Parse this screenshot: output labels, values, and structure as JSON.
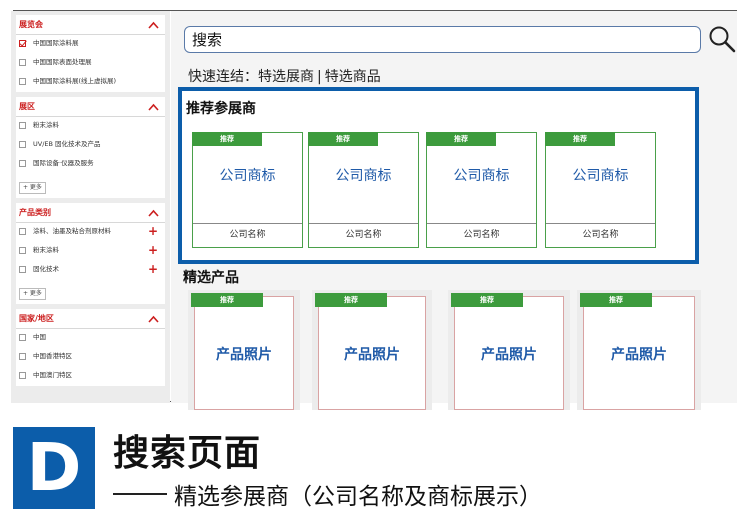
{
  "sidebar": {
    "panels": [
      {
        "title": "展览会",
        "options": [
          {
            "label": "中国国际涂料展",
            "checked": true
          },
          {
            "label": "中国国际表面处理展",
            "checked": false
          },
          {
            "label": "中国国际涂料展(线上虚拟展)",
            "checked": false
          }
        ]
      },
      {
        "title": "展区",
        "options": [
          {
            "label": "粉末涂料",
            "checked": false
          },
          {
            "label": "UV/EB 固化技术及产品",
            "checked": false
          },
          {
            "label": "国际设备·仪器及服务",
            "checked": false
          }
        ],
        "more": "+ 更多"
      },
      {
        "title": "产品类别",
        "options": [
          {
            "label": "涂料、油墨及粘合剂原材料",
            "checked": false
          },
          {
            "label": "粉末涂料",
            "checked": false
          },
          {
            "label": "固化技术",
            "checked": false
          }
        ],
        "more": "+ 更多"
      },
      {
        "title": "国家/地区",
        "options": [
          {
            "label": "中国",
            "checked": false
          },
          {
            "label": "中国香港特区",
            "checked": false
          },
          {
            "label": "中国澳门特区",
            "checked": false
          }
        ]
      }
    ]
  },
  "search": {
    "value": "搜索"
  },
  "quick_links": {
    "prefix": "快速连结：",
    "link1": "特选展商",
    "separator": "|",
    "link2": "特选商品"
  },
  "recommended": {
    "title": "推荐参展商",
    "cards": [
      {
        "badge": "推荐",
        "logo": "公司商标",
        "name": "公司名称"
      },
      {
        "badge": "推荐",
        "logo": "公司商标",
        "name": "公司名称"
      },
      {
        "badge": "推荐",
        "logo": "公司商标",
        "name": "公司名称"
      },
      {
        "badge": "推荐",
        "logo": "公司商标",
        "name": "公司名称"
      }
    ]
  },
  "products": {
    "title": "精选产品",
    "cards": [
      {
        "badge": "推荐",
        "photo": "产品照片"
      },
      {
        "badge": "推荐",
        "photo": "产品照片"
      },
      {
        "badge": "推荐",
        "photo": "产品照片"
      },
      {
        "badge": "推荐",
        "photo": "产品照片"
      }
    ]
  },
  "caption": {
    "letter": "D",
    "title": "搜索页面",
    "subtitle": "精选参展商（公司名称及商标展示）"
  },
  "colors": {
    "accent": "#cc1f1f",
    "brand_blue": "#0c5daa",
    "badge_green": "#3d9b3d",
    "logo_text": "#1f5aa8"
  }
}
